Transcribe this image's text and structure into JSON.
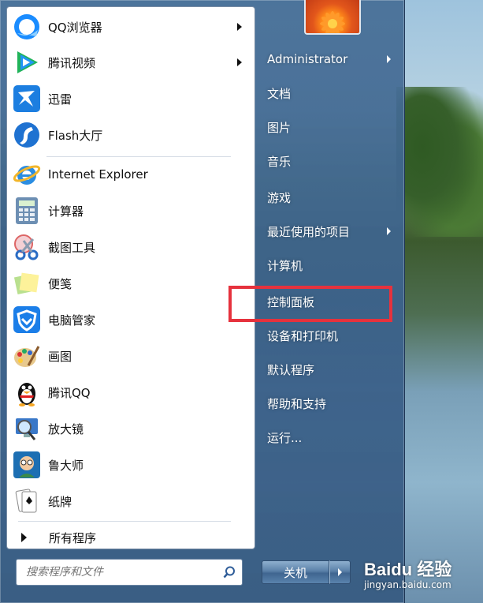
{
  "pinned_apps": [
    {
      "label": "QQ浏览器",
      "icon": "qq-browser-icon",
      "has_submenu": true
    },
    {
      "label": "腾讯视频",
      "icon": "tencent-video-icon",
      "has_submenu": true
    },
    {
      "label": "迅雷",
      "icon": "thunder-icon",
      "has_submenu": false
    },
    {
      "label": "Flash大厅",
      "icon": "flash-icon",
      "has_submenu": false
    }
  ],
  "recent_apps": [
    {
      "label": "Internet Explorer",
      "icon": "ie-icon"
    },
    {
      "label": "计算器",
      "icon": "calculator-icon"
    },
    {
      "label": "截图工具",
      "icon": "snipping-tool-icon"
    },
    {
      "label": "便笺",
      "icon": "sticky-notes-icon"
    },
    {
      "label": "电脑管家",
      "icon": "pc-manager-icon"
    },
    {
      "label": "画图",
      "icon": "paint-icon"
    },
    {
      "label": "腾讯QQ",
      "icon": "qq-penguin-icon"
    },
    {
      "label": "放大镜",
      "icon": "magnifier-icon"
    },
    {
      "label": "鲁大师",
      "icon": "ludashi-icon"
    },
    {
      "label": "纸牌",
      "icon": "solitaire-icon"
    }
  ],
  "all_programs_label": "所有程序",
  "search": {
    "placeholder": "搜索程序和文件",
    "icon": "search-icon"
  },
  "right_menu": [
    {
      "label": "Administrator",
      "has_submenu": true
    },
    {
      "label": "文档",
      "has_submenu": false
    },
    {
      "label": "图片",
      "has_submenu": false
    },
    {
      "label": "音乐",
      "has_submenu": false
    },
    {
      "label": "游戏",
      "has_submenu": false
    },
    {
      "label": "最近使用的项目",
      "has_submenu": true
    },
    {
      "label": "计算机",
      "has_submenu": false
    },
    {
      "label": "控制面板",
      "has_submenu": false,
      "highlighted": true
    },
    {
      "label": "设备和打印机",
      "has_submenu": false
    },
    {
      "label": "默认程序",
      "has_submenu": false
    },
    {
      "label": "帮助和支持",
      "has_submenu": false
    },
    {
      "label": "运行...",
      "has_submenu": false
    }
  ],
  "shutdown_label": "关机",
  "watermark": {
    "brand": "Baidu 经验",
    "site": "jingyan.baidu.com"
  },
  "colors": {
    "highlight": "#e6323d",
    "frame": "#4a7099"
  }
}
